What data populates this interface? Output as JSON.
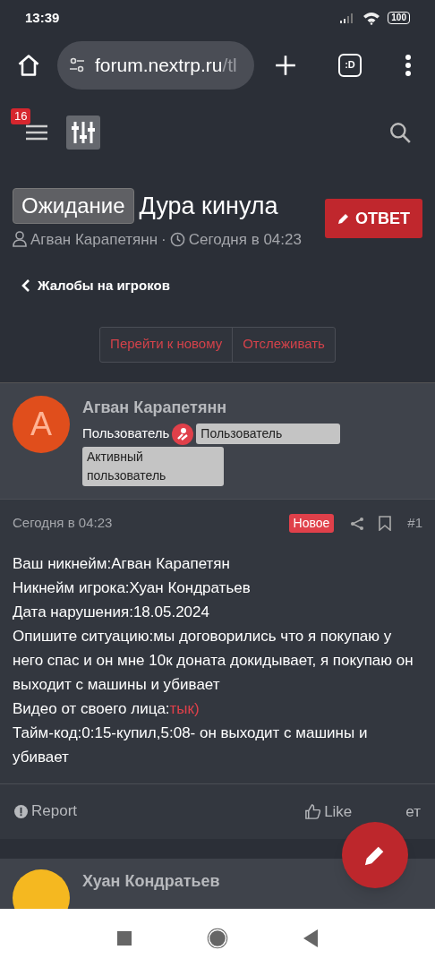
{
  "status_bar": {
    "time": "13:39",
    "battery": "100"
  },
  "browser": {
    "url_host": "forum.nextrp.ru",
    "url_rest": "/tl",
    "tab_switcher": ":D"
  },
  "forum_header": {
    "notification_count": "16"
  },
  "thread": {
    "prefix": "Ожидание",
    "title": "Дура кинула",
    "reply_button": "ОТВЕТ",
    "author": "Агван Карапетянн",
    "separator": "·",
    "date": "Сегодня в 04:23",
    "breadcrumb": "Жалобы на игроков",
    "actions": [
      "Перейти к новому",
      "Отслеживать"
    ]
  },
  "posts": [
    {
      "avatar_letter": "А",
      "color": "#e04e1c",
      "author": "Агван Карапетянн",
      "user_title": "Пользователь",
      "banners": [
        "Пользователь",
        "Активный пользователь"
      ],
      "date": "Сегодня в 04:23",
      "is_new": true,
      "new_label": "Новое",
      "number": "#1",
      "body": [
        {
          "text": "Ваш никнейм:Агван Карапетян"
        },
        {
          "text": "Никнейм игрока:Хуан Кондратьев"
        },
        {
          "text": "Дата нарушения:18.05.2024"
        },
        {
          "text": "Опишите ситуацию:мы договорились что я покупаю у него спас и он мне 10к доната докидывает, я покупаю он выходит с машины и убивает"
        },
        {
          "text": "Видео от своего лица:",
          "link": "тык)"
        },
        {
          "text": "Тайм-код:0:15-купил,5:08- он выходит с машины и убивает"
        }
      ],
      "report": "Report",
      "like": "Like",
      "reply_partial": "ет"
    }
  ],
  "next_post": {
    "author": "Хуан Кондратьев",
    "color": "#f5b820"
  }
}
